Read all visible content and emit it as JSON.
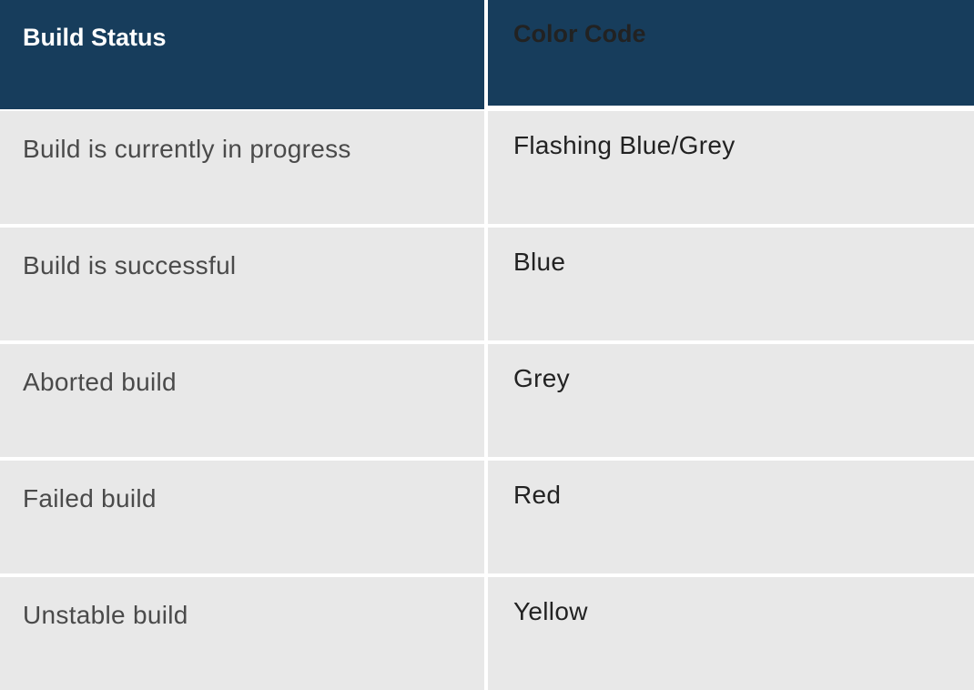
{
  "table": {
    "headers": [
      "Build Status",
      "Color Code"
    ],
    "rows": [
      [
        "Build is currently in progress",
        "Flashing Blue/Grey"
      ],
      [
        "Build is successful",
        "Blue"
      ],
      [
        "Aborted build",
        "Grey"
      ],
      [
        "Failed build",
        "Red"
      ],
      [
        "Unstable build",
        "Yellow"
      ]
    ]
  },
  "colors": {
    "header_bg": "#173d5c",
    "row_bg": "#e8e8e8"
  }
}
